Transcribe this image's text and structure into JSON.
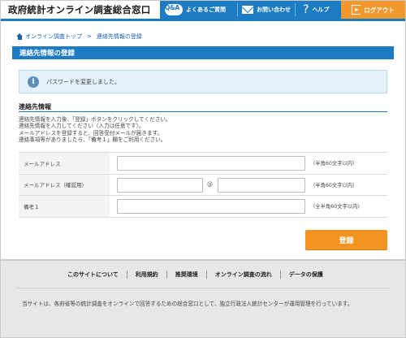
{
  "header": {
    "site_title": "政府統計オンライン調査総合窓口",
    "nav": {
      "faq_icon_text": "Q&A",
      "faq_label": "よくあるご質問",
      "contact_label": "お問い合わせ",
      "help_label": "ヘルプ",
      "logout_label": "ログアウト"
    },
    "colors": {
      "primary": "#1d7bc4",
      "accent": "#f2982c"
    }
  },
  "breadcrumb": {
    "home": "オンライン調査トップ",
    "separator": ">",
    "current": "連絡先情報の登録"
  },
  "page_heading": "連絡先情報の登録",
  "info": {
    "icon": "info-icon",
    "message": "パスワードを変更しました。"
  },
  "section": {
    "title": "連絡先情報",
    "instructions": [
      "連絡先情報を入力後、「登録」ボタンをクリックしてください。",
      "連絡先情報を入力してください（入力は任意です）。",
      "メールアドレスを登録すると、回答受付メールが届きます。",
      "連絡事項等がありましたら、「備考１」欄をご利用ください。"
    ]
  },
  "form": {
    "email": {
      "label": "メールアドレス",
      "value": "",
      "note": "（半角60文字以内）"
    },
    "email_confirm": {
      "label": "メールアドレス（確認用）",
      "at": "@",
      "local_value": "",
      "domain_value": "",
      "note": "（半角60文字以内）"
    },
    "remarks": {
      "label": "備考１",
      "value": "",
      "note": "（全半角60文字以内）"
    }
  },
  "register_button": "登録",
  "footer": {
    "links": [
      "このサイトについて",
      "利用規約",
      "推奨環境",
      "オンライン調査の流れ",
      "データの保護"
    ],
    "note": "当サイトは、各府省等の統計調査をオンラインで回答するための総合窓口として、独立行政法人統計センターが運用管理を行っています。"
  }
}
